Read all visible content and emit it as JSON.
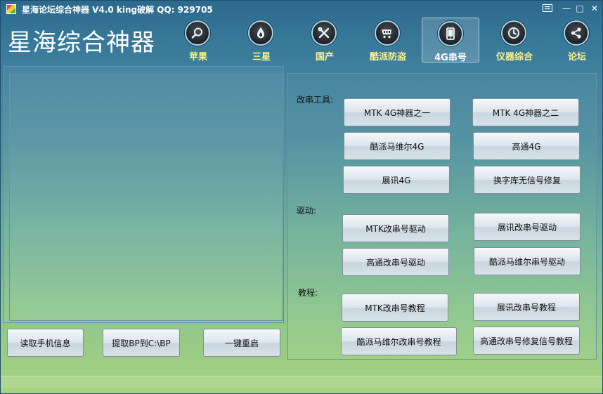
{
  "window": {
    "title": "星海论坛综合神器 V4.0  king破解  QQ: 929705"
  },
  "brand": "星海综合神器",
  "nav": [
    {
      "label": "苹果",
      "icon": "magnifier-icon"
    },
    {
      "label": "三星",
      "icon": "flame-icon"
    },
    {
      "label": "国产",
      "icon": "tools-icon"
    },
    {
      "label": "酷派防盗",
      "icon": "cart-icon"
    },
    {
      "label": "4G串号",
      "icon": "phone-icon"
    },
    {
      "label": "仪器综合",
      "icon": "clock-icon"
    },
    {
      "label": "论坛",
      "icon": "share-icon"
    }
  ],
  "sections": {
    "modify_tools": "改串工具:",
    "driver": "驱动:",
    "tutorial": "教程:"
  },
  "buttons": {
    "mtk_tool_1": "MTK 4G神器之一",
    "mtk_tool_2": "MTK 4G神器之二",
    "coolpad_marvell_4g": "酷派马维尔4G",
    "qualcomm_4g": "高通4G",
    "spreadtrum_4g": "展讯4G",
    "font_lib_no_signal": "换字库无信号修复",
    "mtk_driver": "MTK改串号驱动",
    "spreadtrum_driver": "展讯改串号驱动",
    "qualcomm_driver": "高通改串号驱动",
    "coolpad_marvell_driver": "酷派马维尔串号驱动",
    "mtk_tutorial": "MTK改串号教程",
    "spreadtrum_tutorial": "展讯改串号教程",
    "coolpad_marvell_tutorial": "酷派马维尔改串号教程",
    "qualcomm_tutorial": "高通改串号修复信号教程",
    "read_phone_info": "读取手机信息",
    "extract_bp": "提取BP到C:\\BP",
    "reboot": "一键重启"
  },
  "window_controls": {
    "min": "—",
    "max": "□",
    "close": "✕"
  }
}
